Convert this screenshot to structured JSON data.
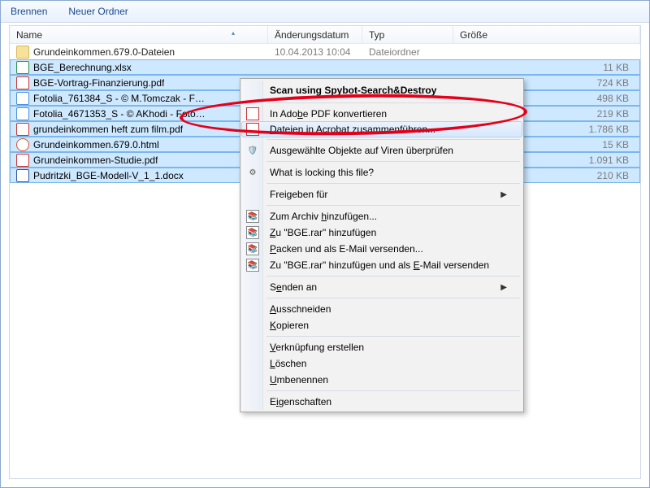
{
  "toolbar": {
    "burn": "Brennen",
    "new_folder": "Neuer Ordner"
  },
  "columns": {
    "name": "Name",
    "date": "Änderungsdatum",
    "type": "Typ",
    "size": "Größe"
  },
  "rows": [
    {
      "icon": "folder",
      "name": "Grundeinkommen.679.0-Dateien",
      "date": "10.04.2013 10:04",
      "type": "Dateiordner",
      "size": "",
      "selected": false
    },
    {
      "icon": "xls",
      "name": "BGE_Berechnung.xlsx",
      "date": "",
      "type": "",
      "size": "11 KB",
      "selected": true
    },
    {
      "icon": "pdf",
      "name": "BGE-Vortrag-Finanzierung.pdf",
      "date": "",
      "type": "",
      "size": "724 KB",
      "selected": true
    },
    {
      "icon": "img",
      "name": "Fotolia_761384_S - © M.Tomczak - F…",
      "date": "",
      "type": "",
      "size": "498 KB",
      "selected": true
    },
    {
      "icon": "img",
      "name": "Fotolia_4671353_S - © AKhodi - Foto…",
      "date": "",
      "type": "",
      "size": "219 KB",
      "selected": true
    },
    {
      "icon": "pdf",
      "name": "grundeinkommen heft zum film.pdf",
      "date": "",
      "type": "",
      "size": "1.786 KB",
      "selected": true
    },
    {
      "icon": "html",
      "name": "Grundeinkommen.679.0.html",
      "date": "",
      "type": "",
      "size": "15 KB",
      "selected": true
    },
    {
      "icon": "pdf",
      "name": "Grundeinkommen-Studie.pdf",
      "date": "",
      "type": "",
      "size": "1.091 KB",
      "selected": true
    },
    {
      "icon": "doc",
      "name": "Pudritzki_BGE-Modell-V_1_1.docx",
      "date": "",
      "type": "",
      "size": "210 KB",
      "selected": true
    }
  ],
  "ctx": {
    "header": "Scan using Spybot-Search&Destroy",
    "adobe_convert": "In Adobe PDF konvertieren",
    "acrobat_combine": "Dateien in Acrobat zusammenführen...",
    "virus_check": "Ausgewählte Objekte auf Viren überprüfen",
    "locking": "What is locking this file?",
    "share": "Freigeben für",
    "archive_add": "Zum Archiv hinzufügen...",
    "rar_add": "Zu \"BGE.rar\" hinzufügen",
    "pack_mail": "Packen und als E-Mail versenden...",
    "rar_mail": "Zu \"BGE.rar\" hinzufügen und als E-Mail versenden",
    "send_to": "Senden an",
    "cut": "Ausschneiden",
    "copy": "Kopieren",
    "shortcut": "Verknüpfung erstellen",
    "delete": "Löschen",
    "rename": "Umbenennen",
    "properties": "Eigenschaften"
  }
}
